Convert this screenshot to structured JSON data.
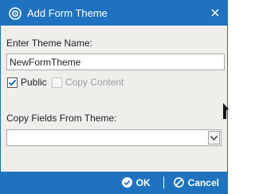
{
  "dialog": {
    "title": "Add Form Theme",
    "accent_color": "#1f72c0",
    "theme_name": {
      "label": "Enter Theme Name:",
      "value": "NewFormTheme"
    },
    "options": {
      "public": {
        "label": "Public",
        "checked": true,
        "enabled": true
      },
      "copy_content": {
        "label": "Copy Content",
        "checked": false,
        "enabled": false
      }
    },
    "copy_fields": {
      "label": "Copy Fields From Theme:",
      "selected": ""
    },
    "footer": {
      "ok_label": "OK",
      "cancel_label": "Cancel"
    },
    "icons": {
      "title": "theme-settings-icon",
      "close": "close-icon",
      "ok": "check-circle-icon",
      "cancel": "cancel-circle-icon",
      "dropdown": "chevron-down-icon"
    }
  }
}
